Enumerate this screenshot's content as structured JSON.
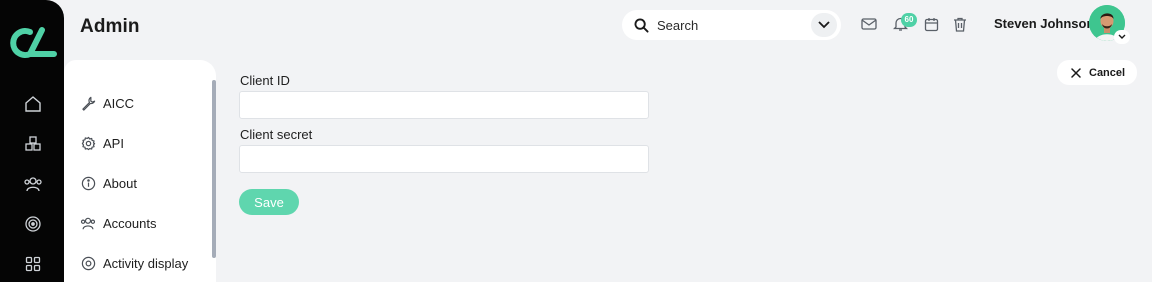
{
  "header": {
    "title": "Admin",
    "search_placeholder": "Search",
    "notification_count": "60",
    "user_name": "Steven Johnson"
  },
  "sidebar_rail": {
    "icons": [
      "home-icon",
      "cubes-icon",
      "users-icon",
      "target-icon",
      "grid-icon"
    ]
  },
  "settings_menu": {
    "items": [
      {
        "label": "AICC",
        "icon": "wrench-icon"
      },
      {
        "label": "API",
        "icon": "gear-icon"
      },
      {
        "label": "About",
        "icon": "info-icon"
      },
      {
        "label": "Accounts",
        "icon": "users-icon"
      },
      {
        "label": "Activity display",
        "icon": "eye-icon"
      }
    ]
  },
  "form": {
    "client_id_label": "Client ID",
    "client_id_value": "",
    "client_secret_label": "Client secret",
    "client_secret_value": "",
    "save_label": "Save",
    "cancel_label": "Cancel"
  },
  "colors": {
    "accent": "#5fd6ae",
    "logo": "#4fd1a6",
    "rail_bg": "#050505",
    "page_bg": "#f2f3f5"
  }
}
